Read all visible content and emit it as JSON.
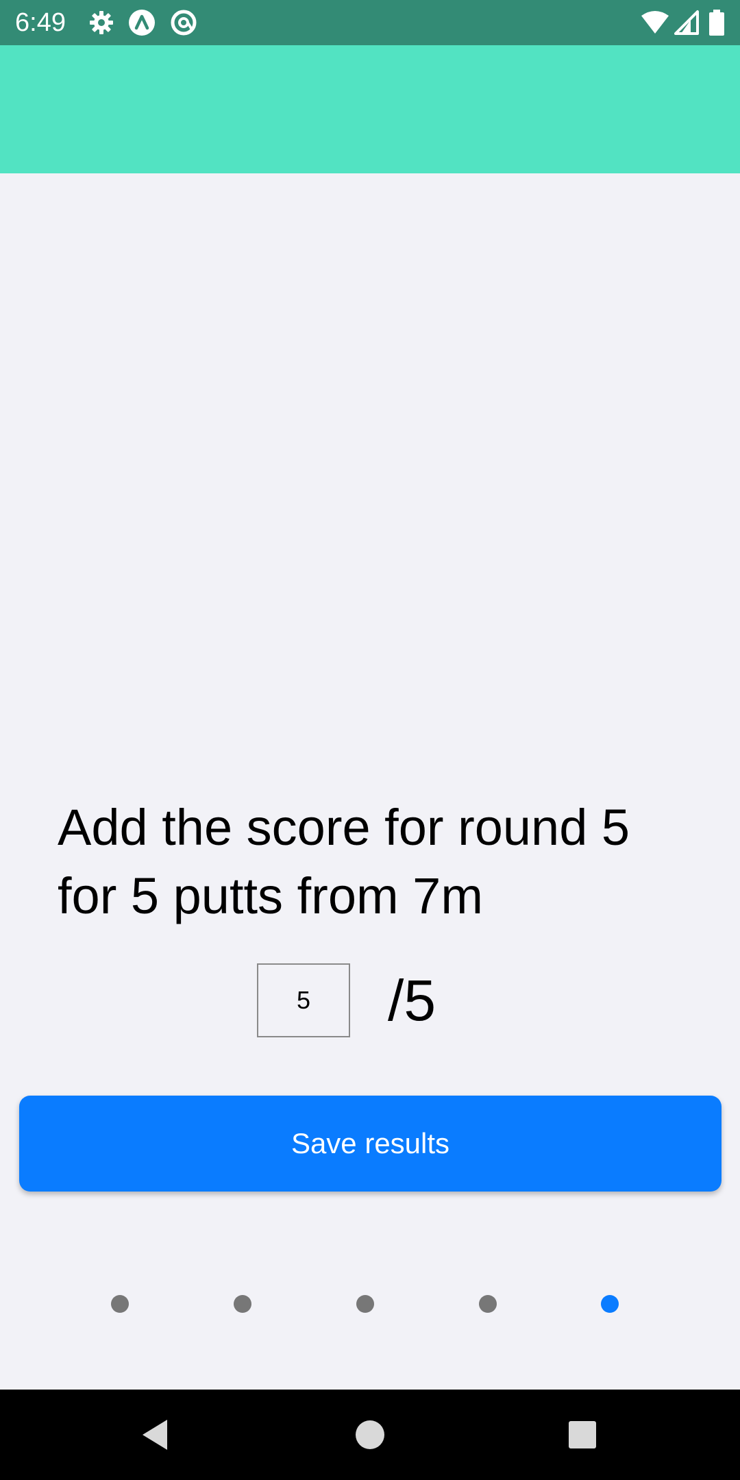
{
  "status_bar": {
    "time": "6:49",
    "left_icons": [
      "gear-icon",
      "app-a-icon",
      "at-icon"
    ],
    "right_icons": [
      "wifi-icon",
      "cellular-signal-icon",
      "battery-icon"
    ],
    "background_color": "#338b75"
  },
  "header": {
    "background_color": "#52e3c2"
  },
  "main": {
    "prompt": "Add the score for round 5 for 5 putts from 7m",
    "score": {
      "input_value": "5",
      "total_label": "/5"
    },
    "save_button_label": "Save results",
    "accent_color": "#0a7cff"
  },
  "pager": {
    "count": 5,
    "active_index": 4
  },
  "nav_bar": {
    "icons": [
      "back-icon",
      "home-icon",
      "recents-icon"
    ]
  }
}
